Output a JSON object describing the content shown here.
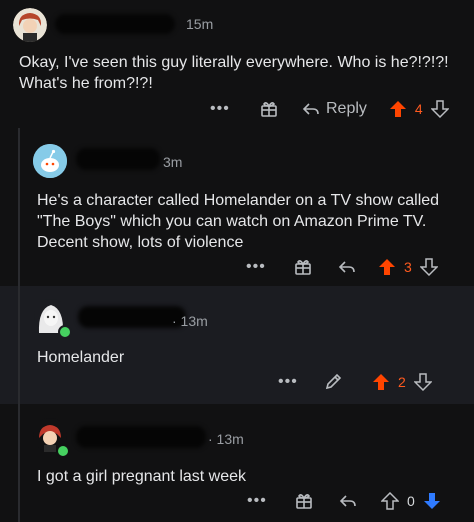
{
  "comments": [
    {
      "time": "15m",
      "body": "Okay, I've seen this guy literally everywhere. Who is he?!?!?! What's he from?!?!",
      "more": "•••",
      "reply_label": "Reply",
      "score": "4",
      "vote_state": "up"
    },
    {
      "time": "3m",
      "body": "He's a character called Homelander on a TV show called \"The Boys\" which you can watch on Amazon Prime TV. Decent show, lots of violence",
      "more": "•••",
      "score": "3",
      "vote_state": "up"
    },
    {
      "time": "· 13m",
      "body": "Homelander",
      "more": "•••",
      "score": "2",
      "vote_state": "up"
    },
    {
      "time": "· 13m",
      "body": "I got a girl pregnant last week",
      "more": "•••",
      "score": "0",
      "vote_state": "down"
    }
  ],
  "icons": {
    "award": "gift-icon",
    "reply": "reply-arrow-icon",
    "edit": "pencil-icon",
    "upvote": "upvote-arrow-icon",
    "downvote": "downvote-arrow-icon"
  },
  "colors": {
    "upvote": "#ff4500",
    "downvote": "#2f7bff",
    "online": "#46d160"
  }
}
